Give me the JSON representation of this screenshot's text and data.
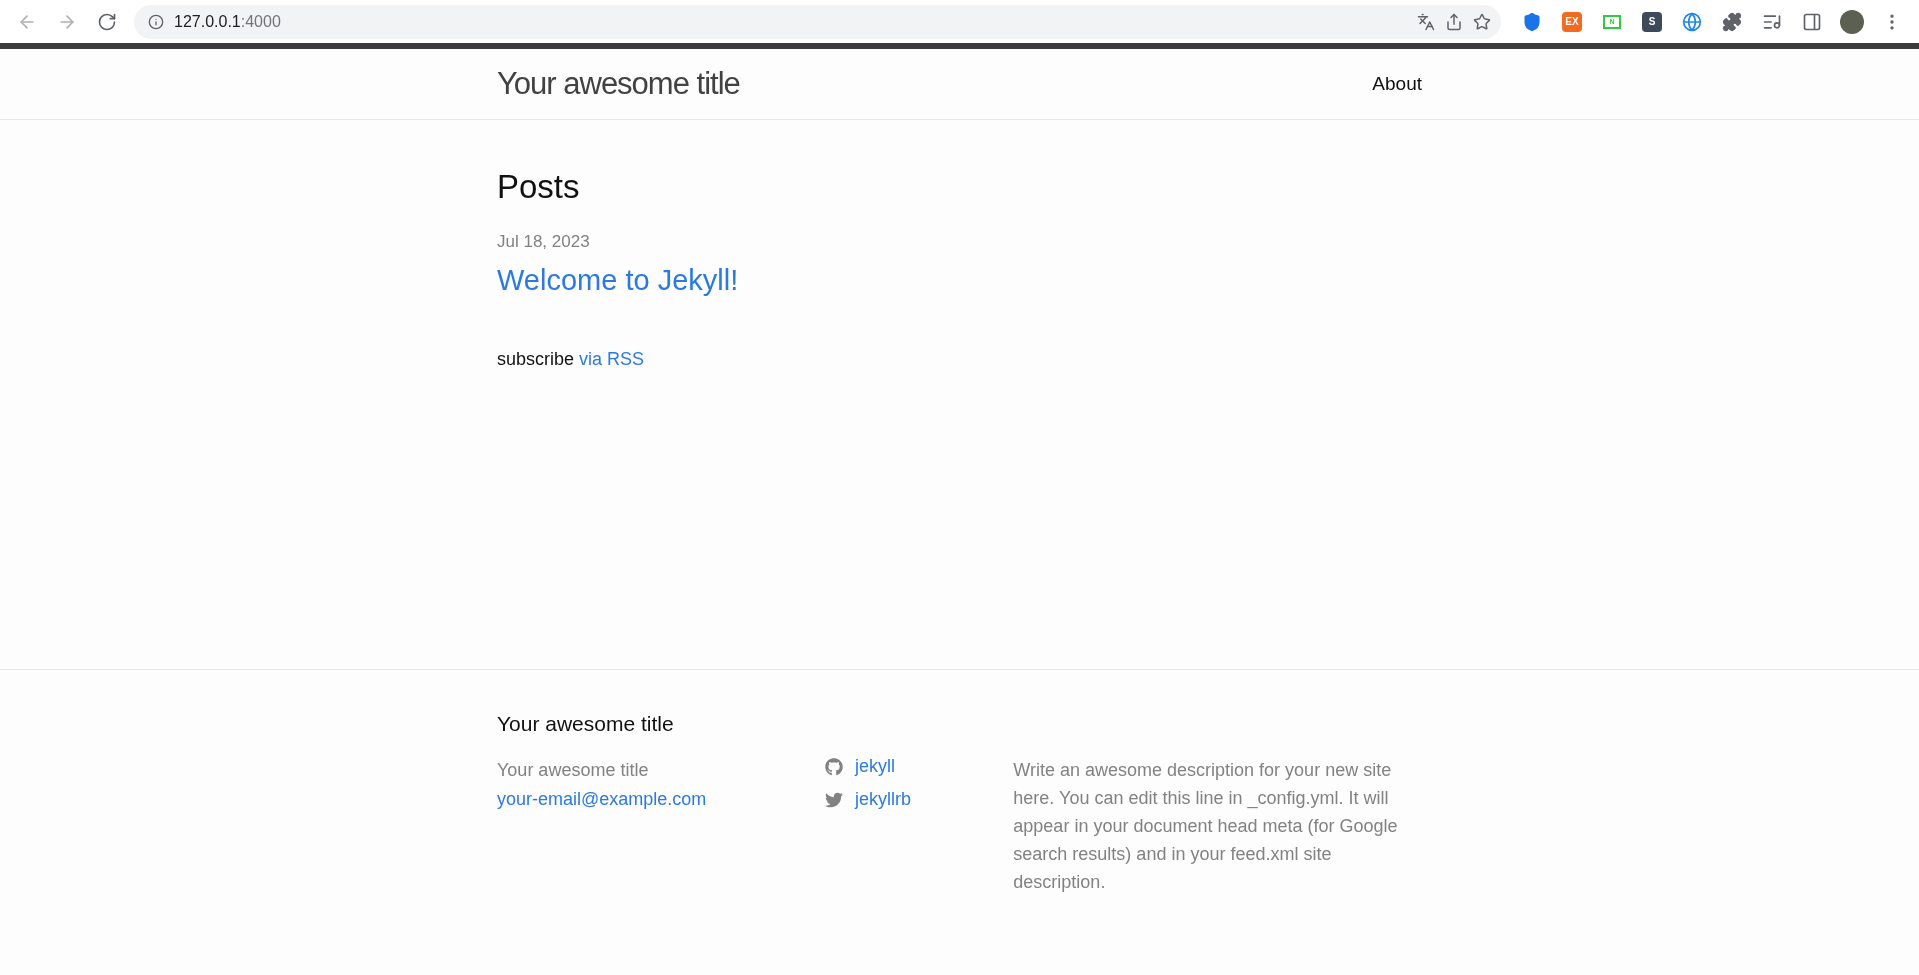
{
  "browser": {
    "url_host": "127.0.0.1",
    "url_port": ":4000",
    "extensions": [
      {
        "kind": "shield"
      },
      {
        "kind": "badge",
        "label": "EX",
        "color": "#f26b21"
      },
      {
        "kind": "screen",
        "label": "N"
      },
      {
        "kind": "badge",
        "label": "S",
        "color": "#3d4a59"
      },
      {
        "kind": "globe"
      },
      {
        "kind": "puzzle"
      }
    ]
  },
  "header": {
    "site_title": "Your awesome title",
    "nav": [
      {
        "label": "About"
      }
    ]
  },
  "main": {
    "heading": "Posts",
    "posts": [
      {
        "date": "Jul 18, 2023",
        "title": "Welcome to Jekyll!"
      }
    ],
    "subscribe_text": "subscribe",
    "subscribe_link": "via RSS"
  },
  "footer": {
    "heading": "Your awesome title",
    "contact_name": "Your awesome title",
    "contact_email": "your-email@example.com",
    "social": [
      {
        "kind": "github",
        "label": "jekyll"
      },
      {
        "kind": "twitter",
        "label": "jekyllrb"
      }
    ],
    "description": "Write an awesome description for your new site here. You can edit this line in _config.yml. It will appear in your document head meta (for Google search results) and in your feed.xml site description."
  }
}
